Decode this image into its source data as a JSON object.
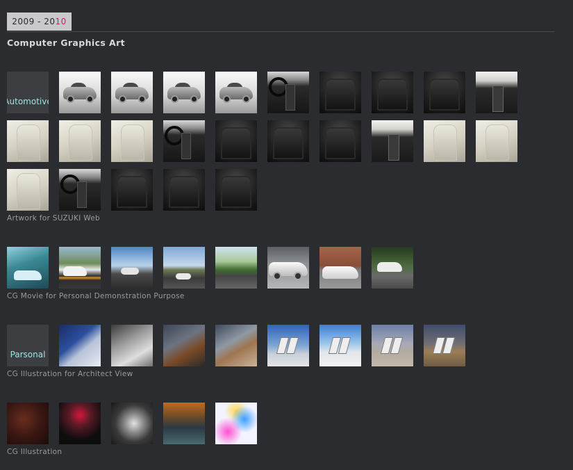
{
  "header": {
    "year_prefix": "2009 - 20",
    "year_suffix": "10",
    "title": "Computer Graphics Art"
  },
  "sections": {
    "automotive": {
      "label": "Automotive",
      "caption": "Artwork for SUZUKI Web"
    },
    "cg_movie": {
      "caption": "CG Movie for Personal Demonstration Purpose"
    },
    "parsonal": {
      "label": "Parsonal",
      "caption": "CG Illustration for Architect View"
    },
    "cg_illustration": {
      "caption": "CG Illustration"
    }
  },
  "colors": {
    "background": "#2b2c30",
    "accent": "#e3166b",
    "label_text": "#9fe3e0"
  }
}
